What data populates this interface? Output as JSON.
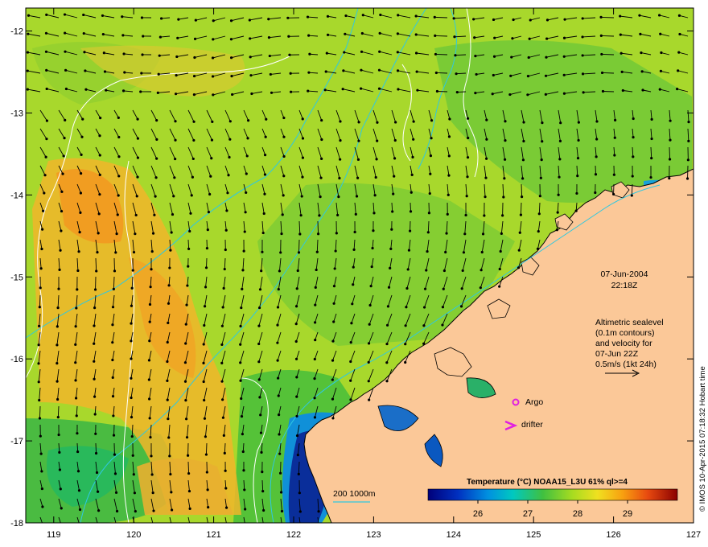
{
  "map": {
    "lon_ticks": [
      "119",
      "120",
      "121",
      "122",
      "123",
      "124",
      "125",
      "126",
      "127"
    ],
    "lat_ticks": [
      "-12",
      "-13",
      "-14",
      "-15",
      "-16",
      "-17",
      "-18"
    ],
    "lon_range": [
      118.65,
      127
    ],
    "lat_range": [
      -18,
      -11.72
    ]
  },
  "annotation": {
    "date": "07-Jun-2004",
    "time": "22:18Z",
    "altimetry_lines": [
      "Altimetric sealevel",
      "(0.1m contours)",
      "and velocity for",
      "07-Jun 22Z",
      "0.5m/s (1kt 24h)"
    ]
  },
  "markers": {
    "argo_label": "Argo",
    "drifter_label": "drifter",
    "argo_color": "#e020e0",
    "drifter_color": "#e020e0"
  },
  "depth_legend": {
    "label": "200  1000m",
    "color": "#30c8e0"
  },
  "colorbar": {
    "title": "Temperature (°C) NOAA15_L3U 61% ql>=4",
    "ticks": [
      "26",
      "27",
      "28",
      "29"
    ],
    "tick_values": [
      26,
      27,
      28,
      29
    ],
    "range": [
      25,
      30
    ]
  },
  "credit": "© IMOS 10-Apr-2015 07:18:32 Hobart time",
  "colors": {
    "land": "#fbc898",
    "coast": "#000000",
    "contour": "#ffffff",
    "isobath": "#30c8e0",
    "warm": "#f5a21e",
    "mid": "#b8dc28",
    "green": "#5ec834",
    "cool": "#0a2e9a"
  }
}
